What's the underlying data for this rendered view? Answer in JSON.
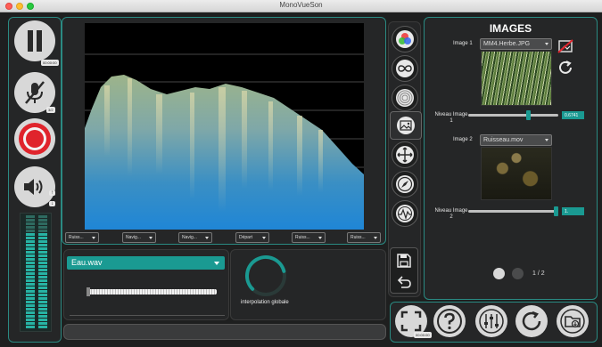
{
  "window": {
    "title": "MonoVueSon"
  },
  "transport": {
    "pause_badge": "00:00:00",
    "mic_badge": "3/2",
    "volume_up": "↑",
    "volume_down": "↓"
  },
  "view": {
    "dropdowns": [
      "Ruiss...",
      "Navig...",
      "Navig...",
      "Départ",
      "Ruiss...",
      "Ruiss..."
    ]
  },
  "audio": {
    "file_select": "Eau.wav",
    "interpolation_label": "interpolation globale",
    "interpolation_level": 0.78
  },
  "images": {
    "title": "IMAGES",
    "image1_label": "Image 1",
    "image1_select": "MM4.Herbe.JPG",
    "level1_label": "Niveau Image 1",
    "level1_value": "0.6741",
    "level1_fraction": 0.6741,
    "image2_label": "Image 2",
    "image2_select": "Ruisseau.mov",
    "level2_label": "Niveau Image 2",
    "level2_value": "1.",
    "level2_fraction": 1.0,
    "pagination": "1 / 2"
  },
  "footer": {
    "fullscreen_badge": "00:00:00"
  },
  "colors": {
    "accent": "#1a9a92",
    "panel_border": "#2a8a82",
    "record": "#e0242c"
  }
}
